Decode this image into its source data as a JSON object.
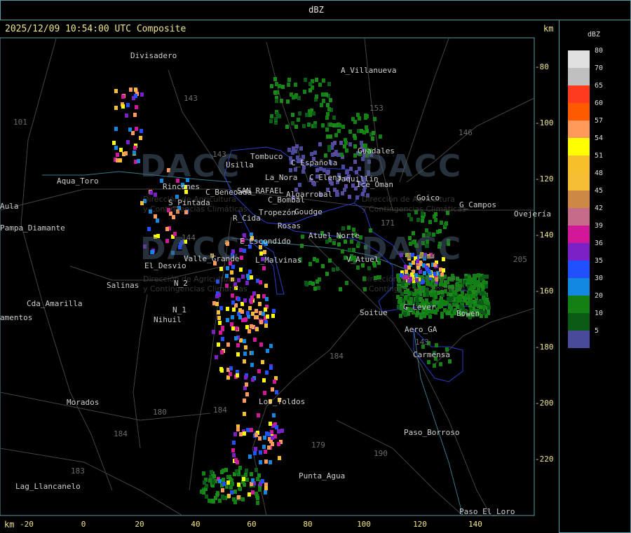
{
  "header": {
    "title": "dBZ"
  },
  "status": {
    "text": "2025/12/09 10:54:00 UTC Composite"
  },
  "units": {
    "top": "km",
    "bottom": "km"
  },
  "y_axis": {
    "ticks": [
      "-80",
      "-100",
      "-120",
      "-140",
      "-160",
      "-180",
      "-200",
      "-220"
    ]
  },
  "x_axis": {
    "ticks": [
      "-20",
      "0",
      "20",
      "40",
      "60",
      "80",
      "100",
      "120",
      "140"
    ]
  },
  "legend": {
    "title": "dBZ",
    "items": [
      {
        "label": "80",
        "color": "#e0e0e0"
      },
      {
        "label": "70",
        "color": "#c0c0c0"
      },
      {
        "label": "65",
        "color": "#ff3b1f"
      },
      {
        "label": "60",
        "color": "#ff5a00"
      },
      {
        "label": "57",
        "color": "#ff9a5a"
      },
      {
        "label": "54",
        "color": "#ffff00"
      },
      {
        "label": "51",
        "color": "#f7c02b"
      },
      {
        "label": "48",
        "color": "#f5bf35"
      },
      {
        "label": "45",
        "color": "#cc8844"
      },
      {
        "label": "42",
        "color": "#c76b8a"
      },
      {
        "label": "39",
        "color": "#d01898"
      },
      {
        "label": "36",
        "color": "#7a22c8"
      },
      {
        "label": "35",
        "color": "#2050ff"
      },
      {
        "label": "30",
        "color": "#1288e0"
      },
      {
        "label": "20",
        "color": "#128012"
      },
      {
        "label": "10",
        "color": "#0a5a18"
      },
      {
        "label": "5",
        "color": "#4a4a9a"
      }
    ]
  },
  "places": [
    {
      "name": "Divisadero"
    },
    {
      "name": "A_Villanueva"
    },
    {
      "name": "Guadales"
    },
    {
      "name": "Usilla"
    },
    {
      "name": "La_Nora"
    },
    {
      "name": "C_Española"
    },
    {
      "name": "C_Elena"
    },
    {
      "name": "Jaquillin"
    },
    {
      "name": "Ice_Oman"
    },
    {
      "name": "SAN_RAFAEL"
    },
    {
      "name": "Algarrobal"
    },
    {
      "name": "C_Bombal"
    },
    {
      "name": "Tropezón"
    },
    {
      "name": "Goudge"
    },
    {
      "name": "Rosas"
    },
    {
      "name": "R_Cida"
    },
    {
      "name": "C_Beneoada"
    },
    {
      "name": "S_Pintada"
    },
    {
      "name": "Aqua_Toro"
    },
    {
      "name": "Pampa_Diamante"
    },
    {
      "name": "El_Desvio"
    },
    {
      "name": "Valle_Grande"
    },
    {
      "name": "E_Escondido"
    },
    {
      "name": "L_Malvinas"
    },
    {
      "name": "Atuel_Norte"
    },
    {
      "name": "V_Atuel"
    },
    {
      "name": "Goico"
    },
    {
      "name": "G_Campos"
    },
    {
      "name": "Ovejería"
    },
    {
      "name": "Salinas"
    },
    {
      "name": "Cda_Amarilla"
    },
    {
      "name": "Nihuil"
    },
    {
      "name": "N_1"
    },
    {
      "name": "N_2"
    },
    {
      "name": "Soitue"
    },
    {
      "name": "G_Lever"
    },
    {
      "name": "Bowen"
    },
    {
      "name": "Aero_GA"
    },
    {
      "name": "Carmensa"
    },
    {
      "name": "Los_Toldos"
    },
    {
      "name": "Morados"
    },
    {
      "name": "Paso_Borroso"
    },
    {
      "name": "Punta_Agua"
    },
    {
      "name": "Lag_Llancanelo"
    },
    {
      "name": "Paso_El_Loro"
    },
    {
      "name": "Tombuco"
    },
    {
      "name": "Rincones"
    },
    {
      "name": "Aula"
    },
    {
      "name": "amentos"
    }
  ],
  "routes": [
    "143",
    "153",
    "146",
    "101",
    "144",
    "171",
    "143",
    "184",
    "180",
    "184",
    "179",
    "190",
    "183",
    "184",
    "205",
    "143"
  ],
  "watermark": {
    "logo": "DACC",
    "subtitle_1": "Dirección de Agricultura",
    "subtitle_2": "y Contingencias Climáticas"
  }
}
